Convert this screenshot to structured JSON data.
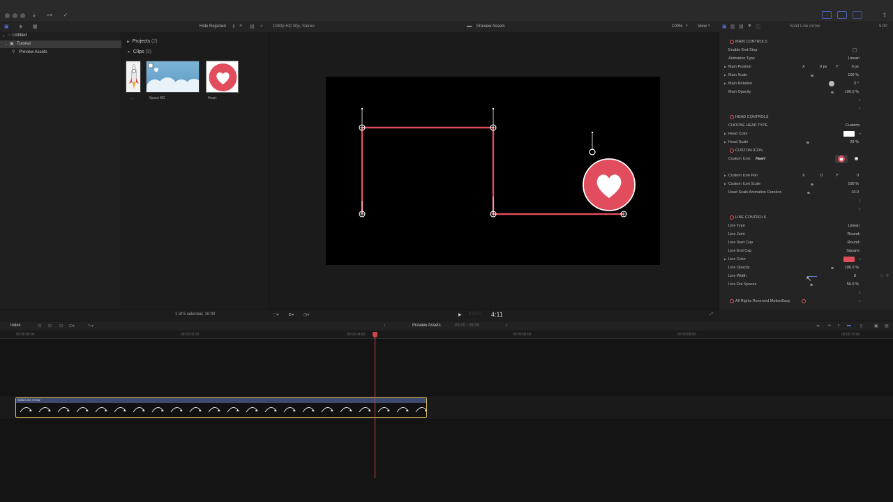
{
  "colors": {
    "accent": "#e14d5c",
    "panel": "#242424",
    "clip_border": "#e3c15a",
    "playhead": "#d14545",
    "selection": "#4a5eb0"
  },
  "toolbar": {
    "hide_rejected": "Hide Rejected",
    "format": "1080p HD 30p, Stereo",
    "viewer_title": "Preview Assets",
    "zoom": "100%",
    "view": "View",
    "inspector_title": "Solid Line Arrow",
    "duration": "5:00"
  },
  "library": {
    "items": [
      {
        "label": "Untitled"
      },
      {
        "label": "Tutorial"
      },
      {
        "label": "Preview Assets"
      }
    ]
  },
  "browser": {
    "projects_label": "Projects",
    "projects_count": "(2)",
    "clips_label": "Clips",
    "clips_count": "(3)",
    "clips": [
      {
        "label": "..."
      },
      {
        "label": "Space BG"
      },
      {
        "label": "Heart"
      }
    ]
  },
  "inspector": {
    "main_controls": "MAIN CONTROLS",
    "enable_end_stop": "Enable End Stop",
    "animation_type": "Animation Type",
    "animation_type_val": "Linear",
    "main_position": "Main Position",
    "main_position_x_label": "X",
    "main_position_x": "0 px",
    "main_position_y_label": "Y",
    "main_position_y": "0 px",
    "main_scale": "Main Scale",
    "main_scale_val": "100 %",
    "main_rotation": "Main Rotation",
    "main_rotation_val": "0 °",
    "main_opacity": "Main Opacity",
    "main_opacity_val": "100.0 %",
    "head_controls": "HEAD CONTROLS",
    "choose_head_type": "CHOOSE HEAD TYPE",
    "choose_head_type_val": "Custom",
    "head_color": "Head Color",
    "head_color_swatch": "#ffffff",
    "head_scale": "Head Scale",
    "head_scale_val": "29 %",
    "custom_icon": "CUSTOM ICON",
    "custom_icon_label": "Custom Icon:",
    "custom_icon_name": "Heart",
    "custom_icon_pan": "Custom Icon Pan",
    "custom_icon_pan_x_label": "X",
    "custom_icon_pan_x": "0",
    "custom_icon_pan_y_label": "Y",
    "custom_icon_pan_y": "0",
    "custom_icon_scale": "Custom Icon Scale",
    "custom_icon_scale_val": "100 %",
    "head_scale_anim": "Head Scale Animation Duration",
    "head_scale_anim_val": "10.0",
    "line_controls": "LINE CONTROLS",
    "line_type": "Line Type",
    "line_type_val": "Linear",
    "line_joint": "Line Joint",
    "line_joint_val": "Round",
    "line_start_cap": "Line Start Cap",
    "line_start_cap_val": "Round",
    "line_end_cap": "Line End Cap",
    "line_end_cap_val": "Square",
    "line_color": "Line Color",
    "line_color_swatch": "#e14d5c",
    "line_opacity": "Line Opacity",
    "line_opacity_val": "100.0 %",
    "line_width": "Line Width",
    "line_width_val": "8",
    "line_dot_spaces": "Line Dot Spaces",
    "line_dot_spaces_val": "50.0 %",
    "copyright": "All Rights Reserved MotionEasy"
  },
  "status": {
    "selection": "1 of 5 selected, 10:00",
    "timecode": "4:11"
  },
  "timeline": {
    "index": "Index",
    "project_name": "Preview Assets",
    "project_duration": "05:00 / 05:00",
    "ruler": [
      "00:00:00:00",
      "00:00:02:00",
      "00:00:04:00",
      "00:00:06:00",
      "00:00:08:00",
      "00:00:10:00"
    ],
    "clip_name": "Solid Line Arrow"
  }
}
